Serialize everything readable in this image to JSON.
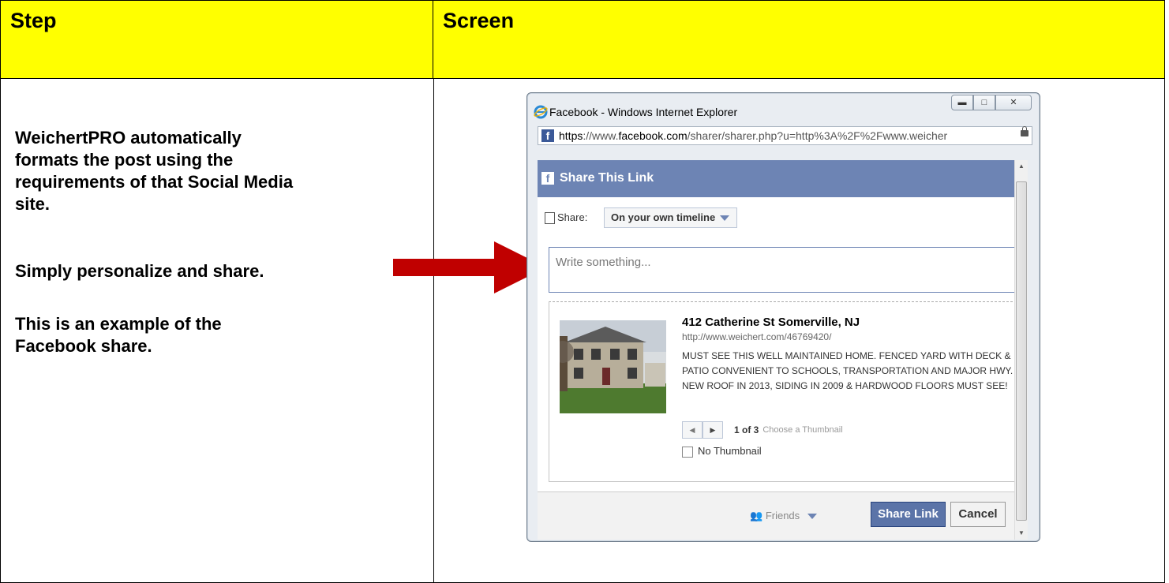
{
  "table": {
    "header_step": "Step",
    "header_screen": "Screen"
  },
  "step": {
    "para1": "WeichertPRO automatically\nformats the post using the\nrequirements of that Social Media\nsite.",
    "para2": "Simply personalize and share.",
    "para3": "This is an example of the\nFacebook share."
  },
  "colors": {
    "header_bg": "#ffff00",
    "arrow": "#c00000",
    "fb_blue": "#6d84b4",
    "share_button": "#5b74a8"
  },
  "browser": {
    "title": "Facebook - Windows Internet Explorer",
    "url_prefix": "https",
    "url_rest": "://www.",
    "url_domain": "facebook.com",
    "url_path": "/sharer/sharer.php?u=http%3A%2F%2Fwww.weicher"
  },
  "dialog": {
    "title": "Share This Link",
    "share_label": "Share:",
    "share_target": "On your own timeline",
    "write_placeholder": "Write something...",
    "listing_title": "412 Catherine St Somerville, NJ",
    "listing_url": "http://www.weichert.com/46769420/",
    "listing_desc": "MUST SEE THIS WELL MAINTAINED HOME. FENCED YARD WITH DECK & PATIO CONVENIENT TO SCHOOLS, TRANSPORTATION AND MAJOR HWY. NEW ROOF IN 2013, SIDING IN 2009 & HARDWOOD FLOORS MUST SEE!",
    "thumb_count": "1 of 3",
    "thumb_choose": "Choose a Thumbnail",
    "no_thumbnail": "No Thumbnail",
    "audience": "Friends",
    "share_button": "Share Link",
    "cancel_button": "Cancel"
  }
}
